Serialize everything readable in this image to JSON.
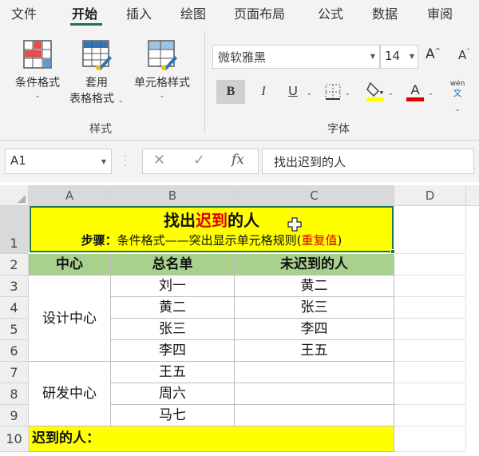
{
  "menu": {
    "tabs": [
      "文件",
      "开始",
      "插入",
      "绘图",
      "页面布局",
      "公式",
      "数据",
      "审阅"
    ],
    "active": "开始"
  },
  "ribbon": {
    "styles_group": {
      "label": "样式",
      "conditional_format": "条件格式",
      "table_format_line1": "套用",
      "table_format_line2": "表格格式",
      "cell_styles": "单元格样式"
    },
    "font_group": {
      "label": "字体",
      "font_name": "微软雅黑",
      "font_size": "14",
      "grow_label": "A",
      "shrink_label": "A",
      "bold": "B",
      "italic": "I",
      "underline": "U",
      "phonetic_pinyin": "wén",
      "phonetic_char": "文"
    },
    "colors": {
      "highlight": "#ffff00",
      "font_color": "#e00000",
      "accent": "#217346"
    }
  },
  "formula_bar": {
    "name_box": "A1",
    "cancel_icon": "✕",
    "enter_icon": "✓",
    "fx": "fx",
    "formula": "找出迟到的人"
  },
  "sheet": {
    "columns": [
      "A",
      "B",
      "C",
      "D"
    ],
    "rows": [
      "1",
      "2",
      "3",
      "4",
      "5",
      "6",
      "7",
      "8",
      "9",
      "10"
    ],
    "title": {
      "part1": "找出",
      "part2": "迟到",
      "part3": "的人",
      "step_label": "步骤：",
      "step_text": "条件格式——突出显示单元格规则(",
      "step_red": "重复值",
      "step_end": ")"
    },
    "headers": {
      "center": "中心",
      "roster": "总名单",
      "not_late": "未迟到的人"
    },
    "groups": [
      {
        "name": "设计中心"
      },
      {
        "name": "研发中心"
      }
    ],
    "roster": [
      "刘一",
      "黄二",
      "张三",
      "李四",
      "王五",
      "周六",
      "马七"
    ],
    "not_late": [
      "黄二",
      "张三",
      "李四",
      "王五"
    ],
    "late_label": "迟到的人："
  }
}
